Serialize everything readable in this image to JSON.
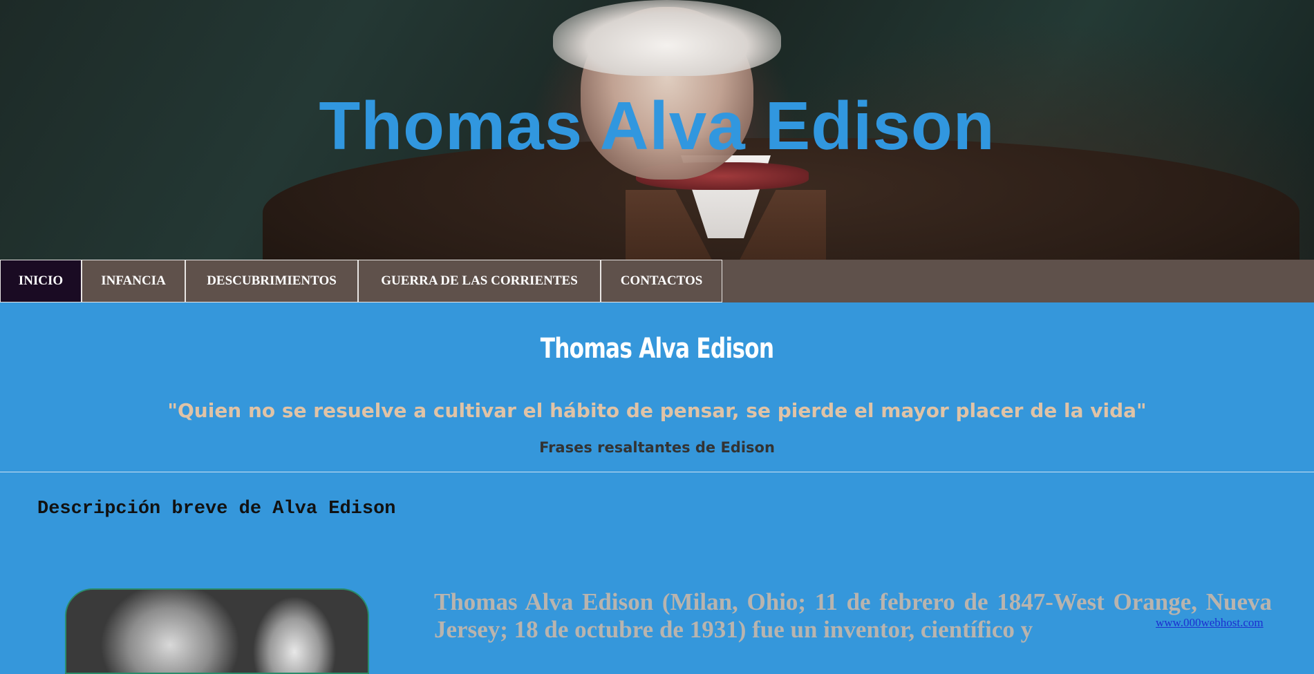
{
  "header": {
    "title": "Thomas Alva Edison"
  },
  "nav": {
    "items": [
      {
        "label": "INICIO",
        "active": true
      },
      {
        "label": "INFANCIA",
        "active": false
      },
      {
        "label": "DESCUBRIMIENTOS",
        "active": false
      },
      {
        "label": "GUERRA DE LAS CORRIENTES",
        "active": false
      },
      {
        "label": "CONTACTOS",
        "active": false
      }
    ]
  },
  "hero": {
    "title": "Thomas Alva Edison",
    "quote": "\"Quien no se resuelve a cultivar el hábito de pensar, se pierde el mayor placer de la vida\"",
    "caption": "Frases resaltantes de Edison"
  },
  "content": {
    "heading": "Descripción breve de Alva Edison",
    "description": "Thomas Alva Edison (Milan, Ohio; 11 de febrero de 1847-West Orange, Nueva Jersey; 18 de octubre de 1931) fue un inventor, científico y",
    "host_link": "www.000webhost.com"
  },
  "colors": {
    "page_background": "#3597db",
    "title_blue": "#3197df",
    "nav_background": "#5f514b",
    "nav_active": "#1a0b23",
    "quote": "#e0c3a6"
  }
}
